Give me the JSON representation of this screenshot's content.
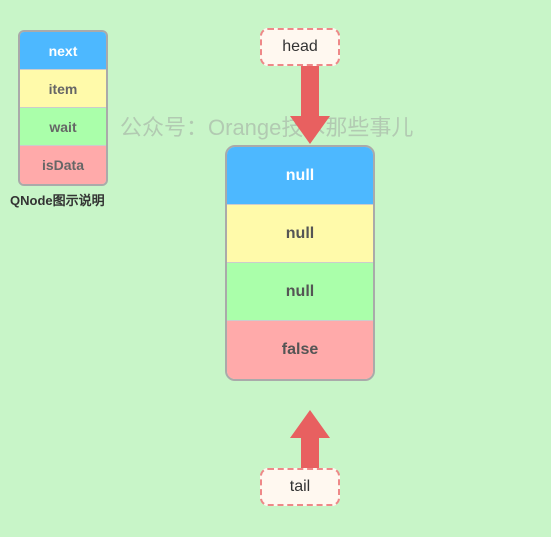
{
  "legend": {
    "rows": [
      {
        "label": "next",
        "class": "legend-next"
      },
      {
        "label": "item",
        "class": "legend-item"
      },
      {
        "label": "wait",
        "class": "legend-wait"
      },
      {
        "label": "isData",
        "class": "legend-isdata"
      }
    ],
    "caption": "QNode图示说明"
  },
  "watermark": "公众号：Orange技术那些事儿",
  "head_label": "head",
  "tail_label": "tail",
  "qnode": {
    "rows": [
      {
        "label": "null",
        "class": "qnode-next"
      },
      {
        "label": "null",
        "class": "qnode-item"
      },
      {
        "label": "null",
        "class": "qnode-wait"
      },
      {
        "label": "false",
        "class": "qnode-isdata"
      }
    ]
  }
}
